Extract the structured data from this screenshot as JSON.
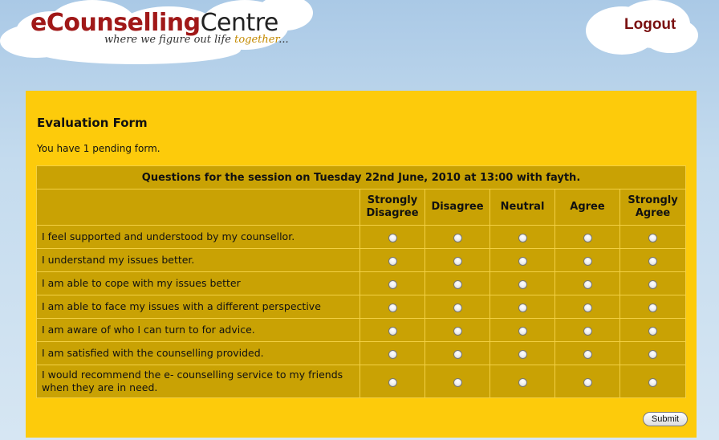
{
  "header": {
    "brand_bold": "eCounselling",
    "brand_light": "Centre",
    "tagline_main": "where we figure out life ",
    "tagline_highlight": "together",
    "tagline_end": "...",
    "logout_label": "Logout"
  },
  "form": {
    "title": "Evaluation Form",
    "pending_text": "You have 1 pending form.",
    "session_caption": "Questions for the session on Tuesday 22nd June, 2010 at 13:00 with fayth.",
    "columns": [
      [
        "Strongly",
        "Disagree"
      ],
      [
        "Disagree"
      ],
      [
        "Neutral"
      ],
      [
        "Agree"
      ],
      [
        "Strongly",
        "Agree"
      ]
    ],
    "questions": [
      "I feel supported and understood by my counsellor.",
      "I understand my issues better.",
      "I am able to cope with my issues better",
      "I am able to face my issues with a different perspective",
      "I am aware of who I can turn to for advice.",
      "I am satisfied with the counselling provided.",
      "I would recommend the e- counselling service to my friends when they are in need."
    ],
    "submit_label": "Submit"
  },
  "colors": {
    "panel": "#fdcb0b",
    "table": "#c9a204",
    "brand_red": "#a01818",
    "logout": "#7a1010"
  }
}
